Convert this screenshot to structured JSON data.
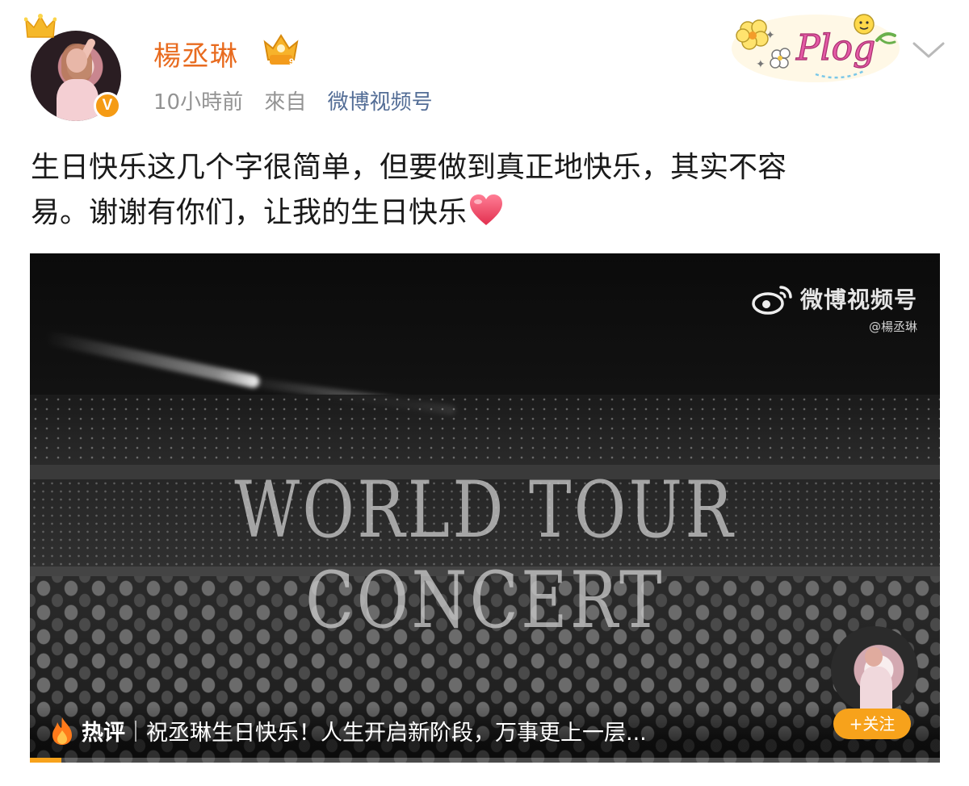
{
  "post": {
    "author": "楊丞琳",
    "time": "10小時前",
    "from_label": "來自",
    "source": "微博视频号",
    "text_line1": "生日快乐这几个字很简单，但要做到真正地快乐，其实不容",
    "text_line2": "易。谢谢有你们，让我的生日快乐",
    "sticker_text": "Plog"
  },
  "video": {
    "overlay_title": "WORLD TOUR CONCERT",
    "watermark_brand": "微博视频号",
    "watermark_handle": "@楊丞琳",
    "hot_label": "热评",
    "hot_comment": "祝丞琳生日快乐！人生开启新阶段，万事更上一层...",
    "follow_label": "+关注",
    "progress": 0.035
  },
  "colors": {
    "username": "#e86b1f",
    "source_link": "#536d96",
    "accent": "#f7a21b"
  },
  "icons": [
    "crown-icon",
    "verified-v-icon",
    "vip-icon",
    "chevron-down-icon",
    "heart-icon",
    "weibo-logo-icon",
    "fire-icon"
  ]
}
